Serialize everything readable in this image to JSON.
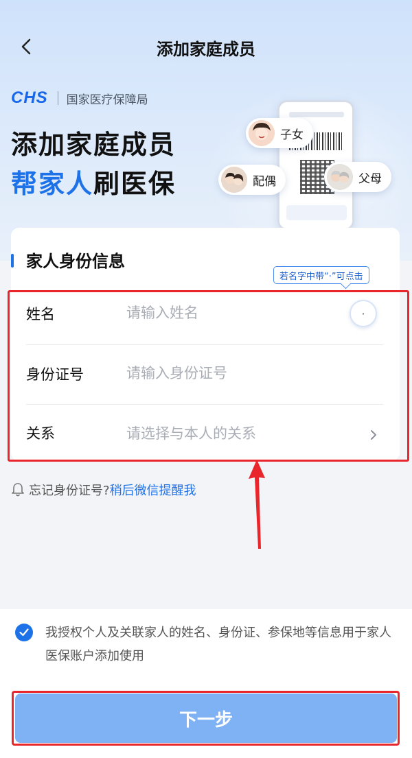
{
  "header": {
    "title": "添加家庭成员"
  },
  "hero": {
    "brand_logo": "CHS",
    "brand_name": "国家医疗保障局",
    "title_line1": "添加家庭成员",
    "title_line2_accent": "帮家人",
    "title_line2_rest": "刷医保",
    "bubbles": {
      "child": "子女",
      "spouse": "配偶",
      "parents": "父母"
    }
  },
  "form": {
    "section_title": "家人身份信息",
    "dot_tip": "若名字中带“·”可点击",
    "dot_button": "·",
    "name": {
      "label": "姓名",
      "placeholder": "请输入姓名",
      "value": ""
    },
    "id_number": {
      "label": "身份证号",
      "placeholder": "请输入身份证号",
      "value": ""
    },
    "relation": {
      "label": "关系",
      "placeholder": "请选择与本人的关系"
    }
  },
  "forgot": {
    "text": "忘记身份证号?",
    "link": "稍后微信提醒我"
  },
  "consent": {
    "checked": true,
    "text": "我授权个人及关联家人的姓名、身份证、参保地等信息用于家人医保账户添加使用"
  },
  "next_button": "下一步",
  "colors": {
    "accent": "#1e72e8",
    "button": "#7fb1f5",
    "annotation": "#e8262c"
  }
}
